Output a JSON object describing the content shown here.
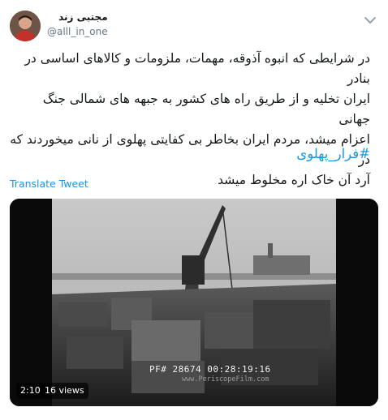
{
  "tweet": {
    "author_name": "مجتبی زند",
    "author_handle": "@alll_in_one",
    "text_lines": [
      "در شرایطی که انبوه آذوقه، مهمات، ملزومات و کالاهای اساسی در بنادر",
      "ایران تخلیه و از طریق راه های کشور به جبهه های شمالی جنگ جهانی",
      "اعزام میشد، مردم ایران بخاطر بی کفایتی پهلوی از نانی میخوردند که در",
      "آرد آن خاک اره مخلوط میشد"
    ],
    "hashtag": "#فرار_پهلوی",
    "translate_label": "Translate Tweet"
  },
  "media": {
    "timecode": "PF# 28674 00:28:19:16",
    "watermark": "www.PeriscopeFilm.com",
    "duration": "2:10",
    "views": "16 views"
  },
  "icons": {
    "menu": "chevron-down-icon"
  },
  "colors": {
    "link": "#1b95e0",
    "secondary_text": "#657786"
  }
}
